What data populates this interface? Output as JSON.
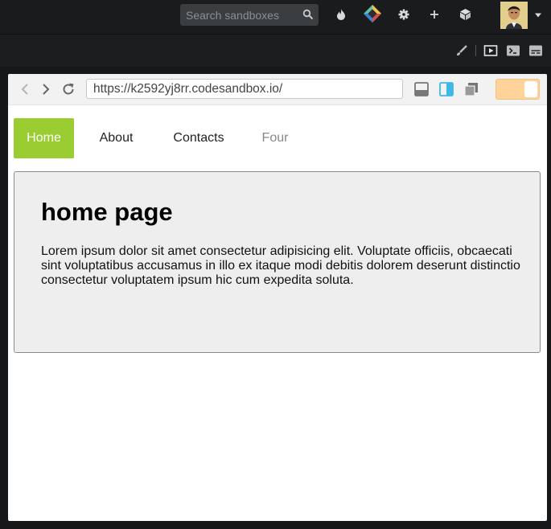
{
  "topbar": {
    "search_placeholder": "Search sandboxes",
    "icons": [
      "search-icon",
      "flame-icon",
      "codesandbox-logo-icon",
      "gear-icon",
      "plus-icon",
      "box-icon",
      "avatar",
      "chevron-down-icon"
    ]
  },
  "toolbar2": {
    "icons": [
      "brush-icon",
      "preview-icon",
      "terminal-icon",
      "console-icon"
    ]
  },
  "browser": {
    "url": "https://k2592yj8rr.codesandbox.io/",
    "icons": [
      "back-icon",
      "forward-icon",
      "refresh-icon",
      "layout-bottom-icon",
      "layout-side-icon",
      "layout-window-icon"
    ]
  },
  "nav": {
    "items": [
      {
        "label": "Home"
      },
      {
        "label": "About"
      },
      {
        "label": "Contacts"
      },
      {
        "label": "Four"
      }
    ]
  },
  "content": {
    "title": "home page",
    "body": "Lorem ipsum dolor sit amet consectetur adipisicing elit. Voluptate officiis, obcaecati sint voluptatibus accusamus in illo ex itaque modi debitis dolorem deserunt distinctio consectetur voluptatem ipsum hic cum expedita soluta."
  },
  "colors": {
    "active_tab": "#9acd32",
    "toggle": "#ffd39a",
    "topbar_bg": "#191b1c"
  }
}
